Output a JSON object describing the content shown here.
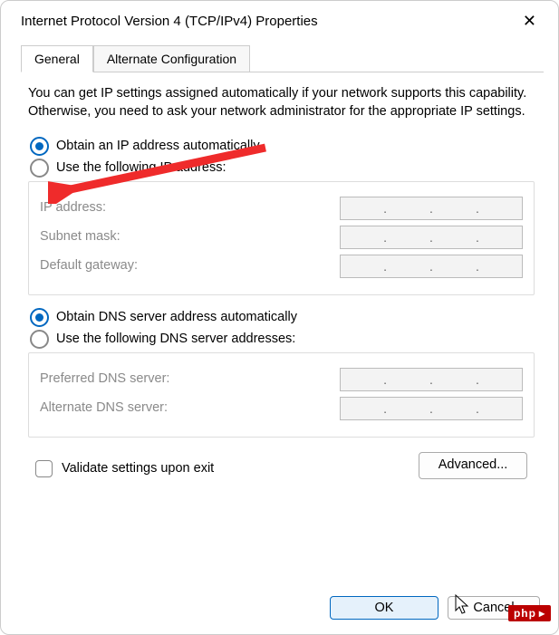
{
  "window": {
    "title": "Internet Protocol Version 4 (TCP/IPv4) Properties"
  },
  "tabs": {
    "general": "General",
    "alternate": "Alternate Configuration"
  },
  "description": "You can get IP settings assigned automatically if your network supports this capability. Otherwise, you need to ask your network administrator for the appropriate IP settings.",
  "ip": {
    "auto": "Obtain an IP address automatically",
    "manual": "Use the following IP address:",
    "address": "IP address:",
    "subnet": "Subnet mask:",
    "gateway": "Default gateway:"
  },
  "dns": {
    "auto": "Obtain DNS server address automatically",
    "manual": "Use the following DNS server addresses:",
    "preferred": "Preferred DNS server:",
    "alternate": "Alternate DNS server:"
  },
  "validate": "Validate settings upon exit",
  "buttons": {
    "advanced": "Advanced...",
    "ok": "OK",
    "cancel": "Cancel"
  },
  "watermark": "php"
}
